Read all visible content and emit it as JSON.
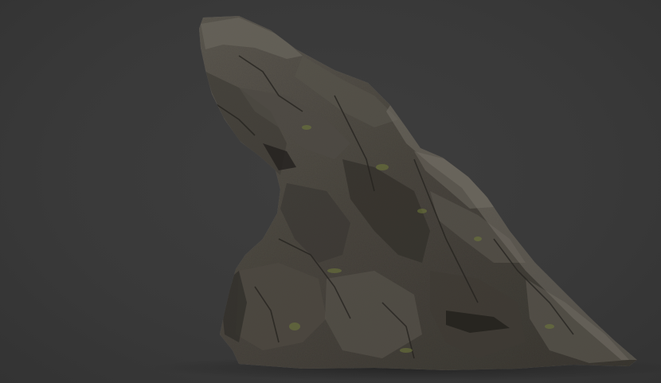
{
  "scene": {
    "subject": "rock-formation",
    "background_color": "#3a3a3a",
    "rock_base_color": "#4a463f",
    "rock_highlight_color": "#6b665c",
    "rock_shadow_color": "#2a2824",
    "moss_color": "#6f7a3a"
  }
}
